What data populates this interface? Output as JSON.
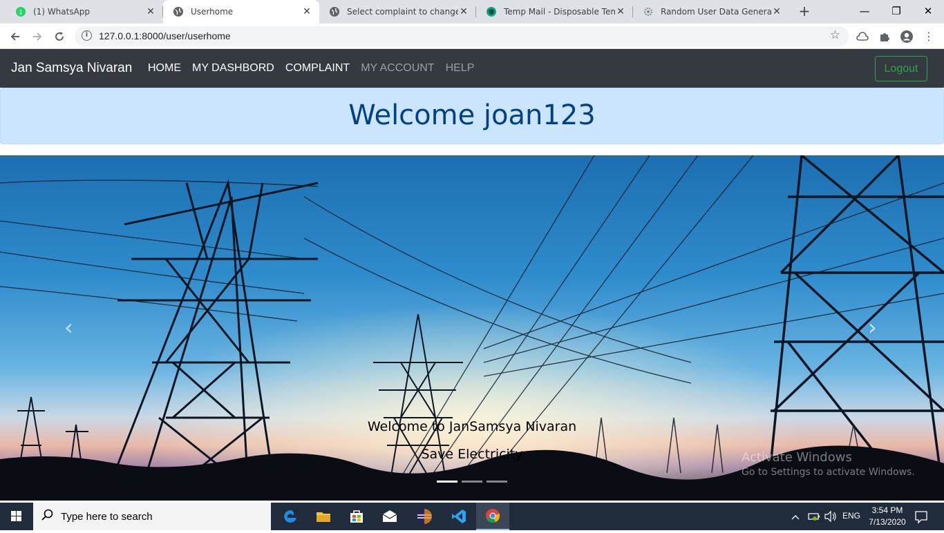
{
  "browser": {
    "tabs": [
      {
        "title": "(1) WhatsApp",
        "active": false
      },
      {
        "title": "Userhome",
        "active": true
      },
      {
        "title": "Select complaint to change | JA",
        "active": false
      },
      {
        "title": "Temp Mail - Disposable Tempo",
        "active": false
      },
      {
        "title": "Random User Data Generator",
        "active": false
      }
    ],
    "url": "127.0.0.1:8000/user/userhome"
  },
  "site": {
    "brand": "Jan Samsya Nivaran",
    "nav": [
      "HOME",
      "MY DASHBORD",
      "COMPLAINT",
      "MY ACCOUNT",
      "HELP"
    ],
    "logout_label": "Logout",
    "welcome": "Welcome joan123",
    "carousel": {
      "caption_line1": "Welcome to JanSamsya Nivaran",
      "caption_line2": "Save Electricity",
      "slide_count": 3,
      "active_slide": 1
    },
    "watermark_title": "Activate Windows",
    "watermark_sub": "Go to Settings to activate Windows."
  },
  "taskbar": {
    "search_placeholder": "Type here to search",
    "language": "ENG",
    "time": "3:54 PM",
    "date": "7/13/2020"
  },
  "colors": {
    "navbar_bg": "#343a40",
    "logout": "#28a745",
    "alert_bg": "#cce5ff",
    "alert_text": "#004085"
  }
}
